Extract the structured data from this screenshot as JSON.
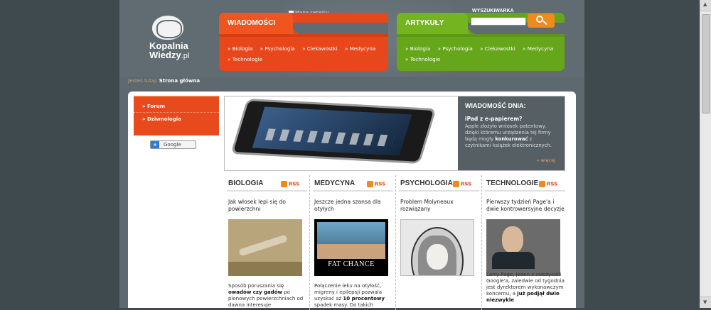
{
  "header": {
    "logo_line1": "Kopalnia",
    "logo_line2": "Wiedzy",
    "logo_suffix": ".pl",
    "sitemap": "Mapa serwisu"
  },
  "nav_orange": {
    "title": "WIADOMOŚCI",
    "links": [
      "Biologia",
      "Psychologia",
      "Ciekawostki",
      "Medycyna",
      "Technologie"
    ]
  },
  "nav_green": {
    "title": "ARTYKUŁY",
    "links": [
      "Biologia",
      "Psychologia",
      "Ciekawostki",
      "Medycyna",
      "Technologie"
    ]
  },
  "search": {
    "label": "WYSZUKIWARKA",
    "value": ""
  },
  "breadcrumb": {
    "label": "Jesteś tutaj:",
    "current": "Strona główna"
  },
  "sidemenu": {
    "items": [
      "Forum",
      "Dziwnologia"
    ]
  },
  "google_button": "Google",
  "news_of_day": {
    "title": "WIADOMOŚĆ DNIA:",
    "headline": "iPad z e-papierem?",
    "text": "Apple złożyło wniosek patentowy, dzięki któremu urządzenia tej firmy będą mogły",
    "text_bold": "konkurować",
    "text_end": "z czytnikami książek elektronicznych.",
    "more": "więcej"
  },
  "columns": [
    {
      "heading": "BIOLOGIA",
      "rss": "RSS",
      "title": "Jak włosek lepi się do powierzchni",
      "desc_a": "Sposób poruszania się",
      "desc_b": "owadów czy gadów",
      "desc_c": "po pionowych powierzchniach od dawna interesuje"
    },
    {
      "heading": "MEDYCYNA",
      "rss": "RSS",
      "title": "Jeszcze jedna szansa dla otyłych",
      "thumb_caption": "FAT CHANCE",
      "desc_a": "Połączenie leku na otyłość, migreny i epilepsji pozwala uzyskać aż",
      "desc_b": "10 procentowy",
      "desc_c": "spadek masy. Do takich"
    },
    {
      "heading": "PSYCHOLOGIA",
      "rss": "RSS",
      "title": "Problem Molyneaux rozwiązany",
      "desc_a": "",
      "desc_b": "",
      "desc_c": ""
    },
    {
      "heading": "TECHNOLOGIE",
      "rss": "RSS",
      "title": "Pierwszy tydzień Page'a i dwie kontrowersyjne decyzje",
      "desc_a": "Larry Page, jeden z założycieli Google'a, zaledwie od tygodnia jest dyrektorem wykonawczym koncernu, a",
      "desc_b": "już podjął dwie niezwykle",
      "desc_c": ""
    }
  ]
}
